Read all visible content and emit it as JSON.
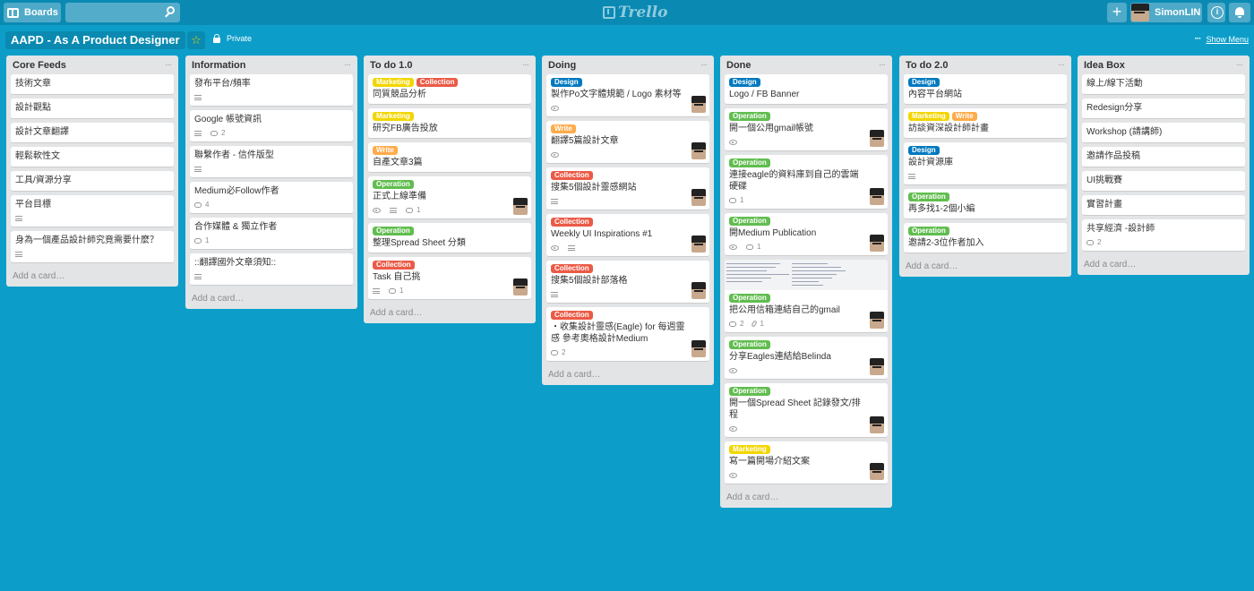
{
  "header": {
    "boards_label": "Boards",
    "logo_text": "Trello",
    "user_name": "SimonLIN"
  },
  "board": {
    "title": "AAPD - As A Product Designer",
    "visibility": "Private",
    "show_menu": "Show Menu"
  },
  "colors": {
    "background": "#0c9ec9",
    "label_design": "#0079bf",
    "label_operation": "#61bd4f",
    "label_collection": "#eb5a46",
    "label_marketing": "#f2d600",
    "label_write": "#ffab4a"
  },
  "add_card_text": "Add a card…",
  "lists": [
    {
      "title": "Core Feeds",
      "cards": [
        {
          "title": "技術文章"
        },
        {
          "title": "設計觀點"
        },
        {
          "title": "設計文章翻譯"
        },
        {
          "title": "輕鬆軟性文"
        },
        {
          "title": "工具/資源分享"
        },
        {
          "title": "平台目標",
          "desc": true
        },
        {
          "title": "身為一個產品設計師究竟需要什麼？",
          "desc": true
        }
      ]
    },
    {
      "title": "Information",
      "cards": [
        {
          "title": "發布平台/頻率",
          "desc": true
        },
        {
          "title": "Google 帳號資訊",
          "desc": true,
          "comments": "2"
        },
        {
          "title": "聯繫作者 - 信件版型",
          "desc": true
        },
        {
          "title": "Medium必Follow作者",
          "comments": "4"
        },
        {
          "title": "合作媒體 & 獨立作者",
          "comments": "1"
        },
        {
          "title": "::翻譯國外文章須知::",
          "desc": true
        }
      ]
    },
    {
      "title": "To do 1.0",
      "cards": [
        {
          "labels": [
            "Marketing",
            "Collection"
          ],
          "title": "同質競品分析"
        },
        {
          "labels": [
            "Marketing"
          ],
          "title": "研究FB廣告投放"
        },
        {
          "labels": [
            "Write"
          ],
          "title": "自產文章3篇"
        },
        {
          "labels": [
            "Operation"
          ],
          "title": "正式上線準備",
          "watch": true,
          "desc": true,
          "comments": "1",
          "avatar": true
        },
        {
          "labels": [
            "Operation"
          ],
          "title": "整理Spread Sheet 分類"
        },
        {
          "labels": [
            "Collection"
          ],
          "title": "Task 自己挑",
          "desc": true,
          "comments": "1",
          "avatar": true
        }
      ]
    },
    {
      "title": "Doing",
      "cards": [
        {
          "labels": [
            "Design"
          ],
          "title": "製作Po文字體規範 / Logo 素材等",
          "watch": true,
          "avatar": true
        },
        {
          "labels": [
            "Write"
          ],
          "title": "翻譯5篇設計文章",
          "watch": true,
          "avatar": true
        },
        {
          "labels": [
            "Collection"
          ],
          "title": "搜集5個設計靈感網站",
          "desc": true,
          "avatar": true
        },
        {
          "labels": [
            "Collection"
          ],
          "title": "Weekly UI Inspirations #1",
          "watch": true,
          "desc": true,
          "avatar": true
        },
        {
          "labels": [
            "Collection"
          ],
          "title": "搜集5個設計部落格",
          "desc": true,
          "avatar": true
        },
        {
          "labels": [
            "Collection"
          ],
          "title": "・收集設計靈感(Eagle) for 每週靈感 參考奧格設計Medium",
          "comments": "2",
          "avatar": true
        }
      ]
    },
    {
      "title": "Done",
      "cards": [
        {
          "labels": [
            "Design"
          ],
          "title": "Logo / FB Banner"
        },
        {
          "labels": [
            "Operation"
          ],
          "title": "開一個公用gmail帳號",
          "watch": true,
          "avatar": true
        },
        {
          "labels": [
            "Operation"
          ],
          "title": "連接eagle的資料庫到自己的雲端硬碟",
          "comments": "1",
          "avatar": true
        },
        {
          "labels": [
            "Operation"
          ],
          "title": "開Medium Publication",
          "watch": true,
          "comments": "1",
          "avatar": true
        },
        {
          "cover": true,
          "labels": [
            "Operation"
          ],
          "title": "把公用信箱連結自己的gmail",
          "comments": "2",
          "attachments": "1",
          "avatar": true
        },
        {
          "labels": [
            "Operation"
          ],
          "title": "分享Eagles連結給Belinda",
          "watch": true,
          "avatar": true
        },
        {
          "labels": [
            "Operation"
          ],
          "title": "開一個Spread Sheet 記錄發文/排程",
          "watch": true,
          "avatar": true
        },
        {
          "labels": [
            "Marketing"
          ],
          "title": "寫一篇開場介紹文案",
          "watch": true,
          "avatar": true
        }
      ]
    },
    {
      "title": "To do 2.0",
      "cards": [
        {
          "labels": [
            "Design"
          ],
          "title": "內容平台網站"
        },
        {
          "labels": [
            "Marketing",
            "Write"
          ],
          "title": "訪談資深設計師計畫"
        },
        {
          "labels": [
            "Design"
          ],
          "title": "設計資源庫",
          "desc": true
        },
        {
          "labels": [
            "Operation"
          ],
          "title": "再多找1-2個小編"
        },
        {
          "labels": [
            "Operation"
          ],
          "title": "邀請2-3位作者加入"
        }
      ]
    },
    {
      "title": "Idea Box",
      "cards": [
        {
          "title": "線上/線下活動"
        },
        {
          "title": "Redesign分享"
        },
        {
          "title": "Workshop (請講師)"
        },
        {
          "title": "邀請作品投稿"
        },
        {
          "title": "UI挑戰賽"
        },
        {
          "title": "實習計畫"
        },
        {
          "title": "共享經濟 -設計師",
          "comments": "2"
        }
      ]
    }
  ]
}
